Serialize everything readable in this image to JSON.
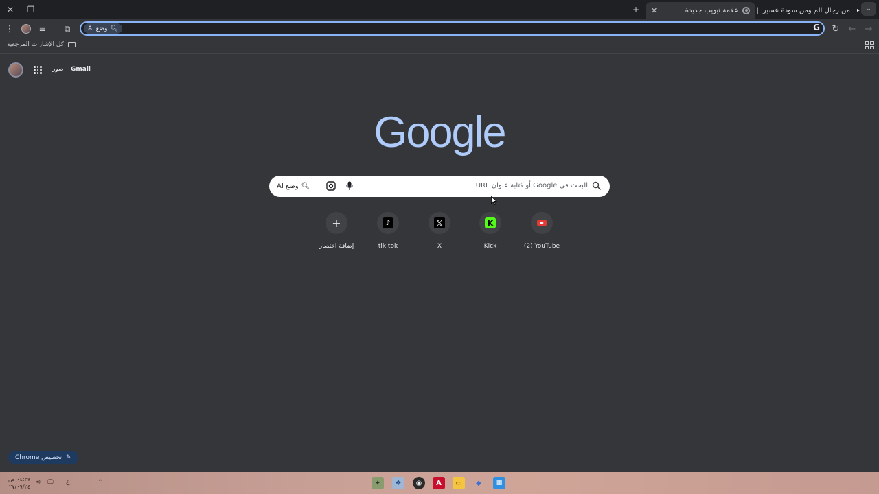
{
  "tabs": [
    {
      "title": "من رجال الم ومن سودة عسيرا |",
      "active": false
    },
    {
      "title": "علامة تبويب جديدة",
      "active": true
    }
  ],
  "toolbar": {
    "omnibox_ai_label": "وضع AI",
    "omnibox_value": ""
  },
  "bookmarks": {
    "all_bookmarks_label": "كل الإشارات المرجعية"
  },
  "ntp": {
    "gmail_label": "Gmail",
    "images_label": "صور",
    "logo_text": "Google",
    "search_placeholder": "البحث في Google أو كتابة عنوان URL",
    "ai_mode_label": "وضع AI",
    "customize_label": "تخصيص Chrome",
    "shortcuts": [
      {
        "label": "(2) YouTube",
        "icon": "youtube-icon"
      },
      {
        "label": "Kick",
        "icon": "kick-icon"
      },
      {
        "label": "X",
        "icon": "x-icon"
      },
      {
        "label": "tik tok",
        "icon": "tiktok-icon"
      },
      {
        "label": "إضافة اختصار",
        "icon": "plus-icon"
      }
    ]
  },
  "taskbar": {
    "time": "٠٤:٣٧ ص",
    "date": "٢٧/٠٩/٢٤",
    "language": "ع"
  },
  "colors": {
    "page_bg": "#35363a",
    "tabstrip_bg": "#1f2024",
    "accent": "#8ab4f8",
    "logo": "#aecbfa"
  }
}
